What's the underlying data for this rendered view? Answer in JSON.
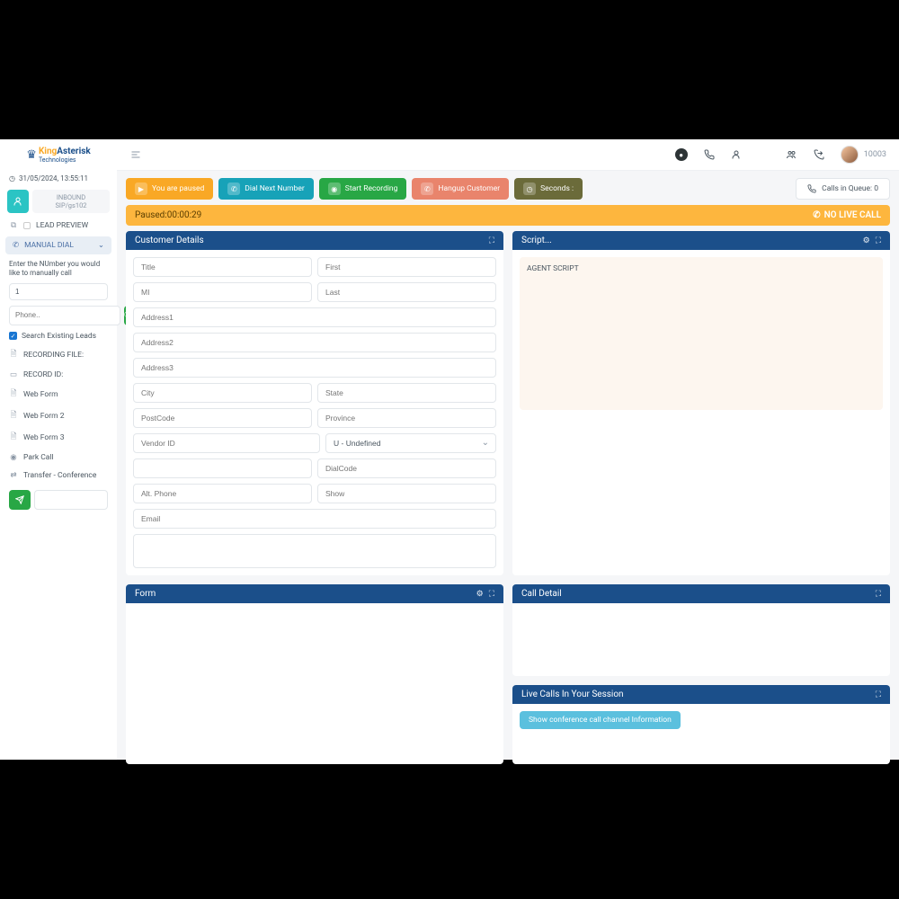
{
  "header": {
    "logo_king": "King",
    "logo_asterisk": "Asterisk",
    "logo_sub": "Technologies",
    "user_id": "10003",
    "notif_badge": "●"
  },
  "sidebar": {
    "datetime": "31/05/2024, 13:55:11",
    "inbound_label": "INBOUND",
    "inbound_ext": "SIP/gs102",
    "lead_preview": "LEAD PREVIEW",
    "manual_dial": "MANUAL DIAL",
    "manual_note": "Enter the NUmber you would like to manually call",
    "manual_value": "1",
    "phone_placeholder": "Phone..",
    "search_existing": "Search Existing Leads",
    "items": [
      "RECORDING FILE:",
      "RECORD ID:",
      "Web Form",
      "Web Form 2",
      "Web Form 3",
      "Park Call",
      "Transfer - Conference"
    ]
  },
  "actions": {
    "paused": "You are paused",
    "dial_next": "Dial Next Number",
    "start_rec": "Start Recording",
    "hangup": "Hangup Customer",
    "seconds": "Seconds :",
    "queue_label": "Calls in Queue: 0"
  },
  "status": {
    "paused_label": "Paused:",
    "paused_time": "00:00:29",
    "no_live": "NO LIVE CALL"
  },
  "panels": {
    "customer_details": "Customer Details",
    "script_title": "Script...",
    "script_body": "AGENT SCRIPT",
    "form_title": "Form",
    "call_detail": "Call Detail",
    "live_calls": "Live Calls In Your Session",
    "show_conf": "Show conference call channel Information"
  },
  "customer_form": {
    "title": "Title",
    "first": "First",
    "mi": "MI",
    "last": "Last",
    "address1": "Address1",
    "address2": "Address2",
    "address3": "Address3",
    "city": "City",
    "state": "State",
    "postcode": "PostCode",
    "province": "Province",
    "vendor": "Vendor ID",
    "gender_selected": "U - Undefined",
    "dialcode": "DialCode",
    "altphone": "Alt. Phone",
    "show": "Show",
    "email": "Email"
  }
}
